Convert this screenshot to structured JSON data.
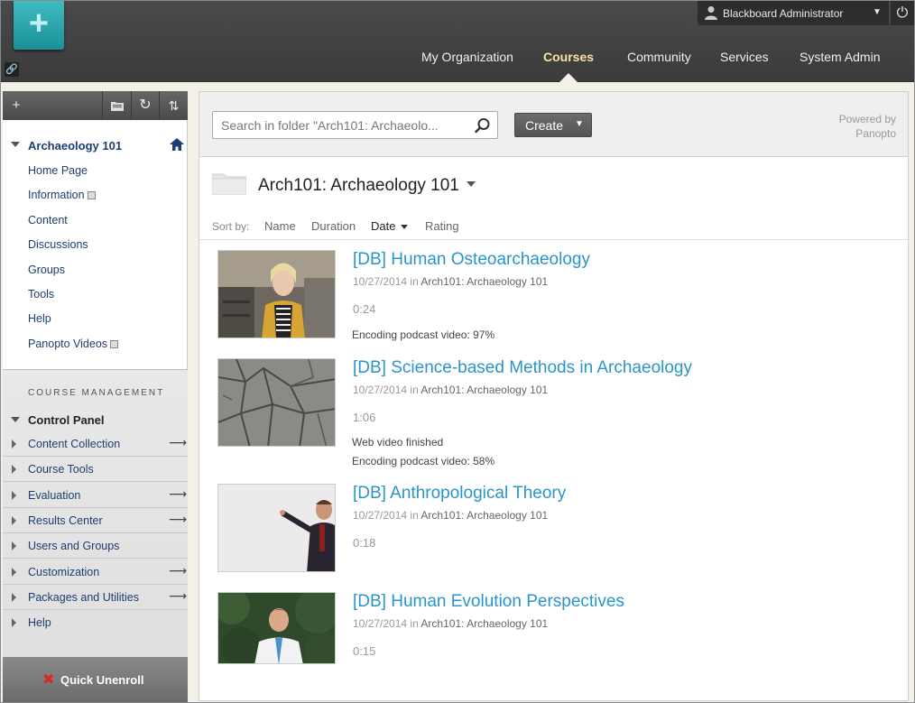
{
  "header": {
    "user_name": "Blackboard Administrator",
    "tabs": [
      {
        "label": "My Organization",
        "active": false
      },
      {
        "label": "Courses",
        "active": true
      },
      {
        "label": "Community",
        "active": false
      },
      {
        "label": "Services",
        "active": false
      },
      {
        "label": "System Admin",
        "active": false
      }
    ]
  },
  "nav": {
    "course_title": "Archaeology 101",
    "items": [
      "Home Page",
      "Information",
      "Content",
      "Discussions",
      "Groups",
      "Tools",
      "Help",
      "Panopto Videos"
    ],
    "course_management_label": "COURSE MANAGEMENT",
    "control_panel_title": "Control Panel",
    "control_panel_items": [
      {
        "label": "Content Collection",
        "arrow": true
      },
      {
        "label": "Course Tools",
        "arrow": false
      },
      {
        "label": "Evaluation",
        "arrow": true
      },
      {
        "label": "Results Center",
        "arrow": true
      },
      {
        "label": "Users and Groups",
        "arrow": false
      },
      {
        "label": "Customization",
        "arrow": true
      },
      {
        "label": "Packages and Utilities",
        "arrow": true
      },
      {
        "label": "Help",
        "arrow": false
      }
    ],
    "quick_unenroll": "Quick Unenroll"
  },
  "main": {
    "search_placeholder": "Search in folder \"Arch101: Archaeolo...",
    "create_label": "Create",
    "powered_by": "Powered by",
    "powered_brand": "Panopto",
    "folder_title": "Arch101: Archaeology 101",
    "sort_by_label": "Sort by:",
    "sort_options": [
      "Name",
      "Duration",
      "Date",
      "Rating"
    ],
    "sort_active": "Date",
    "sessions": [
      {
        "title": "[DB] Human Osteoarchaeology",
        "date": "10/27/2014",
        "in_label": "in",
        "folder": "Arch101: Archaeology 101",
        "duration": "0:24",
        "status": [
          "Encoding podcast video: 97%"
        ]
      },
      {
        "title": "[DB] Science-based Methods in Archaeology",
        "date": "10/27/2014",
        "in_label": "in",
        "folder": "Arch101: Archaeology 101",
        "duration": "1:06",
        "status": [
          "Web video finished",
          "Encoding podcast video: 58%"
        ]
      },
      {
        "title": "[DB] Anthropological Theory",
        "date": "10/27/2014",
        "in_label": "in",
        "folder": "Arch101: Archaeology 101",
        "duration": "0:18",
        "status": []
      },
      {
        "title": "[DB] Human Evolution Perspectives",
        "date": "10/27/2014",
        "in_label": "in",
        "folder": "Arch101: Archaeology 101",
        "duration": "0:15",
        "status": []
      }
    ]
  },
  "colors": {
    "accent_link": "#2a95c8",
    "nav_link": "#1e3d6e",
    "active_tab": "#f7e3a8",
    "logo_teal": "#1c8f97"
  }
}
